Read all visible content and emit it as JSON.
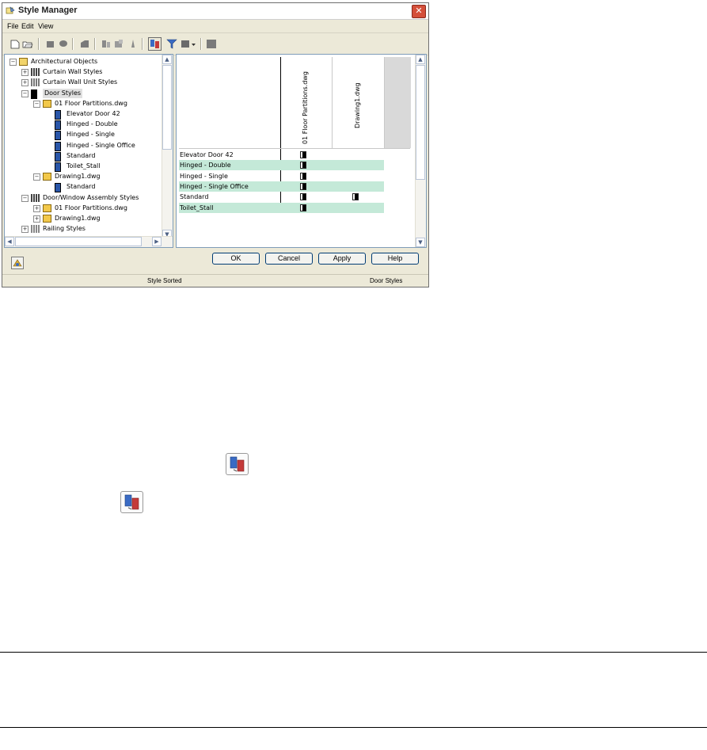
{
  "window": {
    "title": "Style Manager",
    "close_glyph": "✕",
    "app_icon": "style-manager-icon"
  },
  "menu": [
    "File",
    "Edit",
    "View"
  ],
  "toolbar": {
    "icons": [
      "new-drawing-icon",
      "open-drawing-icon",
      "copy-icon",
      "paste-icon",
      "edit-style-icon",
      "purge-icon",
      "set-from-icon",
      "inventory-icon",
      "toggle-view-icon",
      "filter-icon",
      "object-type-dropdown-icon",
      "show-all-icon"
    ]
  },
  "tree": {
    "nodes": [
      {
        "label": "Architectural Objects",
        "level": 0,
        "expander": "−",
        "icon": "folder-icon"
      },
      {
        "label": "Curtain Wall Styles",
        "level": 1,
        "expander": "+",
        "icon": "curtain-wall-icon"
      },
      {
        "label": "Curtain Wall Unit Styles",
        "level": 1,
        "expander": "+",
        "icon": "curtain-wall-unit-icon"
      },
      {
        "label": "Door Styles",
        "level": 1,
        "expander": "−",
        "icon": "door-icon",
        "selected": true
      },
      {
        "label": "01 Floor Partitions.dwg",
        "level": 2,
        "expander": "−",
        "icon": "drawing-file-icon"
      },
      {
        "label": "Elevator Door 42",
        "level": 3,
        "expander": "",
        "icon": "door-style-icon"
      },
      {
        "label": "Hinged - Double",
        "level": 3,
        "expander": "",
        "icon": "door-style-icon"
      },
      {
        "label": "Hinged - Single",
        "level": 3,
        "expander": "",
        "icon": "door-style-icon"
      },
      {
        "label": "Hinged - Single Office",
        "level": 3,
        "expander": "",
        "icon": "door-style-icon"
      },
      {
        "label": "Standard",
        "level": 3,
        "expander": "",
        "icon": "door-style-icon"
      },
      {
        "label": "Toilet_Stall",
        "level": 3,
        "expander": "",
        "icon": "door-style-icon"
      },
      {
        "label": "Drawing1.dwg",
        "level": 2,
        "expander": "−",
        "icon": "drawing-file-icon"
      },
      {
        "label": "Standard",
        "level": 3,
        "expander": "",
        "icon": "door-style-icon"
      },
      {
        "label": "Door/Window Assembly Styles",
        "level": 1,
        "expander": "−",
        "icon": "door-window-assembly-icon"
      },
      {
        "label": "01 Floor Partitions.dwg",
        "level": 2,
        "expander": "+",
        "icon": "drawing-file-icon"
      },
      {
        "label": "Drawing1.dwg",
        "level": 2,
        "expander": "+",
        "icon": "drawing-file-icon"
      },
      {
        "label": "Railing Styles",
        "level": 1,
        "expander": "+",
        "icon": "railing-icon"
      }
    ]
  },
  "grid": {
    "columns": [
      "01 Floor Partitions.dwg",
      "Drawing1.dwg"
    ],
    "rows": [
      {
        "label": "Elevator Door 42",
        "in": [
          true,
          false
        ]
      },
      {
        "label": "Hinged - Double",
        "in": [
          true,
          false
        ]
      },
      {
        "label": "Hinged - Single",
        "in": [
          true,
          false
        ]
      },
      {
        "label": "Hinged - Single Office",
        "in": [
          true,
          false
        ]
      },
      {
        "label": "Standard",
        "in": [
          true,
          true
        ]
      },
      {
        "label": "Toilet_Stall",
        "in": [
          true,
          false
        ]
      }
    ]
  },
  "buttons": {
    "ok": "OK",
    "cancel": "Cancel",
    "apply": "Apply",
    "help": "Help"
  },
  "status": {
    "center": "Style Sorted",
    "right": "Door Styles"
  },
  "doc_icons": [
    "toggle-view-icon",
    "toggle-view-icon"
  ]
}
